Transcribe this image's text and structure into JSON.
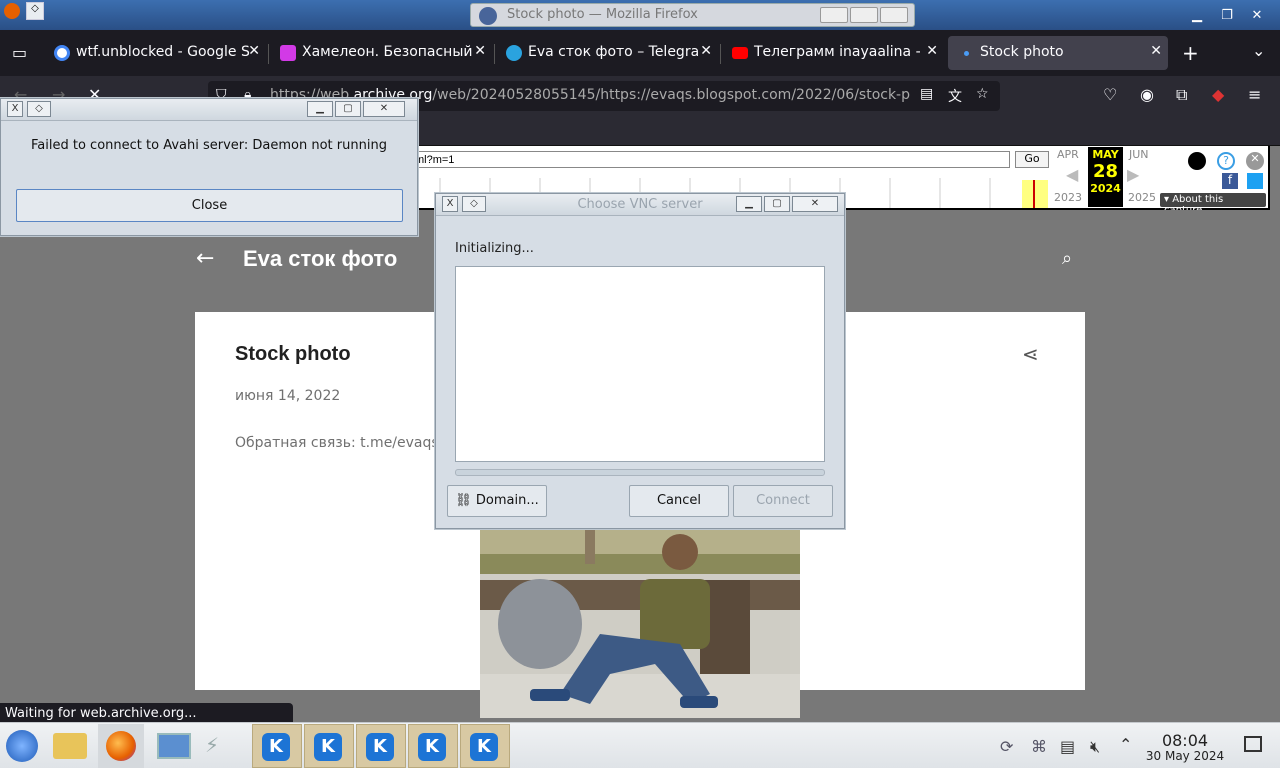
{
  "window": {
    "title": "Stock photo — Mozilla Firefox"
  },
  "tabs": [
    {
      "label": "wtf.unblocked - Google S",
      "favicon": "google-icon",
      "color": "#4285f4"
    },
    {
      "label": "Хамелеон. Безопасный",
      "favicon": "chameleon-icon",
      "color": "#d23ae6"
    },
    {
      "label": "Eva сток фото – Telegra",
      "favicon": "telegram-icon",
      "color": "#2aa3df"
    },
    {
      "label": "Телеграмм inayaalina -",
      "favicon": "youtube-icon",
      "color": "#ff0000"
    },
    {
      "label": "Stock photo",
      "favicon": "loading-dot-icon",
      "color": "#4a9cf5"
    }
  ],
  "urlbar": {
    "url_prefix": "https://web.",
    "url_domain": "archive.org",
    "url_rest": "/web/20240528055145/https://evaqs.blogspot.com/2022/06/stock-p"
  },
  "wayback": {
    "url_field": "ml?m=1",
    "go": "Go",
    "prev_month": "APR",
    "month": "MAY",
    "day": "28",
    "year": "2024",
    "next_month": "JUN",
    "prev_year": "2023",
    "next_year": "2025",
    "about": "About this capture"
  },
  "blog": {
    "title": "Eva сток фото",
    "post_title": "Stock photo",
    "post_date": "июня 14, 2022",
    "feedback": "Обратная связь: t.me/evaqs"
  },
  "status": "Waiting for web.archive.org...",
  "avahi_dialog": {
    "message": "Failed to connect to Avahi server: Daemon not running",
    "close": "Close"
  },
  "vnc_dialog": {
    "title": "Choose VNC server",
    "status": "Initializing...",
    "domain": "Domain...",
    "cancel": "Cancel",
    "connect": "Connect"
  },
  "clock": {
    "time": "08:04",
    "date": "30 May 2024"
  }
}
